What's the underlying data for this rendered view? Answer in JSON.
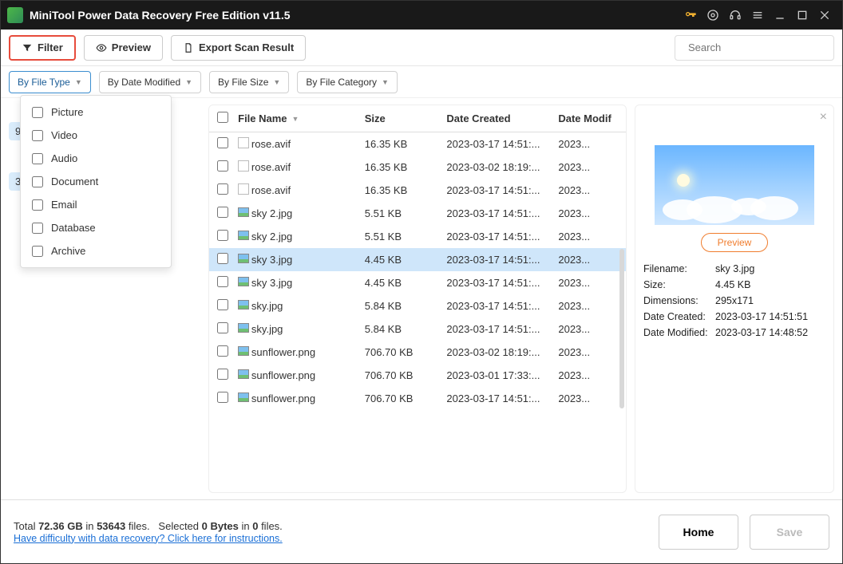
{
  "titlebar": {
    "title": "MiniTool Power Data Recovery Free Edition v11.5"
  },
  "toolbar": {
    "filter": "Filter",
    "preview": "Preview",
    "export": "Export Scan Result"
  },
  "search": {
    "placeholder": "Search"
  },
  "filters": {
    "type": "By File Type",
    "date": "By Date Modified",
    "size": "By File Size",
    "category": "By File Category"
  },
  "typeMenu": [
    "Picture",
    "Video",
    "Audio",
    "Document",
    "Email",
    "Database",
    "Archive"
  ],
  "sidebar": {
    "badge1": "9)",
    "badge2": "38)"
  },
  "columns": {
    "name": "File Name",
    "size": "Size",
    "created": "Date Created",
    "modified": "Date Modif"
  },
  "rows": [
    {
      "icon": "file",
      "name": "rose.avif",
      "size": "16.35 KB",
      "created": "2023-03-17 14:51:...",
      "mod": "2023...",
      "sel": false
    },
    {
      "icon": "file",
      "name": "rose.avif",
      "size": "16.35 KB",
      "created": "2023-03-02 18:19:...",
      "mod": "2023...",
      "sel": false
    },
    {
      "icon": "file",
      "name": "rose.avif",
      "size": "16.35 KB",
      "created": "2023-03-17 14:51:...",
      "mod": "2023...",
      "sel": false
    },
    {
      "icon": "img",
      "name": "sky 2.jpg",
      "size": "5.51 KB",
      "created": "2023-03-17 14:51:...",
      "mod": "2023...",
      "sel": false
    },
    {
      "icon": "img",
      "name": "sky 2.jpg",
      "size": "5.51 KB",
      "created": "2023-03-17 14:51:...",
      "mod": "2023...",
      "sel": false
    },
    {
      "icon": "img",
      "name": "sky 3.jpg",
      "size": "4.45 KB",
      "created": "2023-03-17 14:51:...",
      "mod": "2023...",
      "sel": true
    },
    {
      "icon": "img",
      "name": "sky 3.jpg",
      "size": "4.45 KB",
      "created": "2023-03-17 14:51:...",
      "mod": "2023...",
      "sel": false
    },
    {
      "icon": "img",
      "name": "sky.jpg",
      "size": "5.84 KB",
      "created": "2023-03-17 14:51:...",
      "mod": "2023...",
      "sel": false
    },
    {
      "icon": "img",
      "name": "sky.jpg",
      "size": "5.84 KB",
      "created": "2023-03-17 14:51:...",
      "mod": "2023...",
      "sel": false
    },
    {
      "icon": "img",
      "name": "sunflower.png",
      "size": "706.70 KB",
      "created": "2023-03-02 18:19:...",
      "mod": "2023...",
      "sel": false
    },
    {
      "icon": "img",
      "name": "sunflower.png",
      "size": "706.70 KB",
      "created": "2023-03-01 17:33:...",
      "mod": "2023...",
      "sel": false
    },
    {
      "icon": "img",
      "name": "sunflower.png",
      "size": "706.70 KB",
      "created": "2023-03-17 14:51:...",
      "mod": "2023...",
      "sel": false
    }
  ],
  "preview": {
    "button": "Preview",
    "labels": {
      "filename": "Filename:",
      "size": "Size:",
      "dim": "Dimensions:",
      "created": "Date Created:",
      "modified": "Date Modified:"
    },
    "filename": "sky 3.jpg",
    "size": "4.45 KB",
    "dim": "295x171",
    "created": "2023-03-17 14:51:51",
    "modified": "2023-03-17 14:48:52"
  },
  "footer": {
    "total_pre": "Total ",
    "total_gb": "72.36 GB",
    "total_mid": " in ",
    "total_files": "53643",
    "total_post": " files.",
    "sel_pre": "Selected ",
    "sel_bytes": "0 Bytes",
    "sel_mid": " in ",
    "sel_count": "0",
    "sel_post": " files.",
    "help": "Have difficulty with data recovery? Click here for instructions.",
    "home": "Home",
    "save": "Save"
  }
}
